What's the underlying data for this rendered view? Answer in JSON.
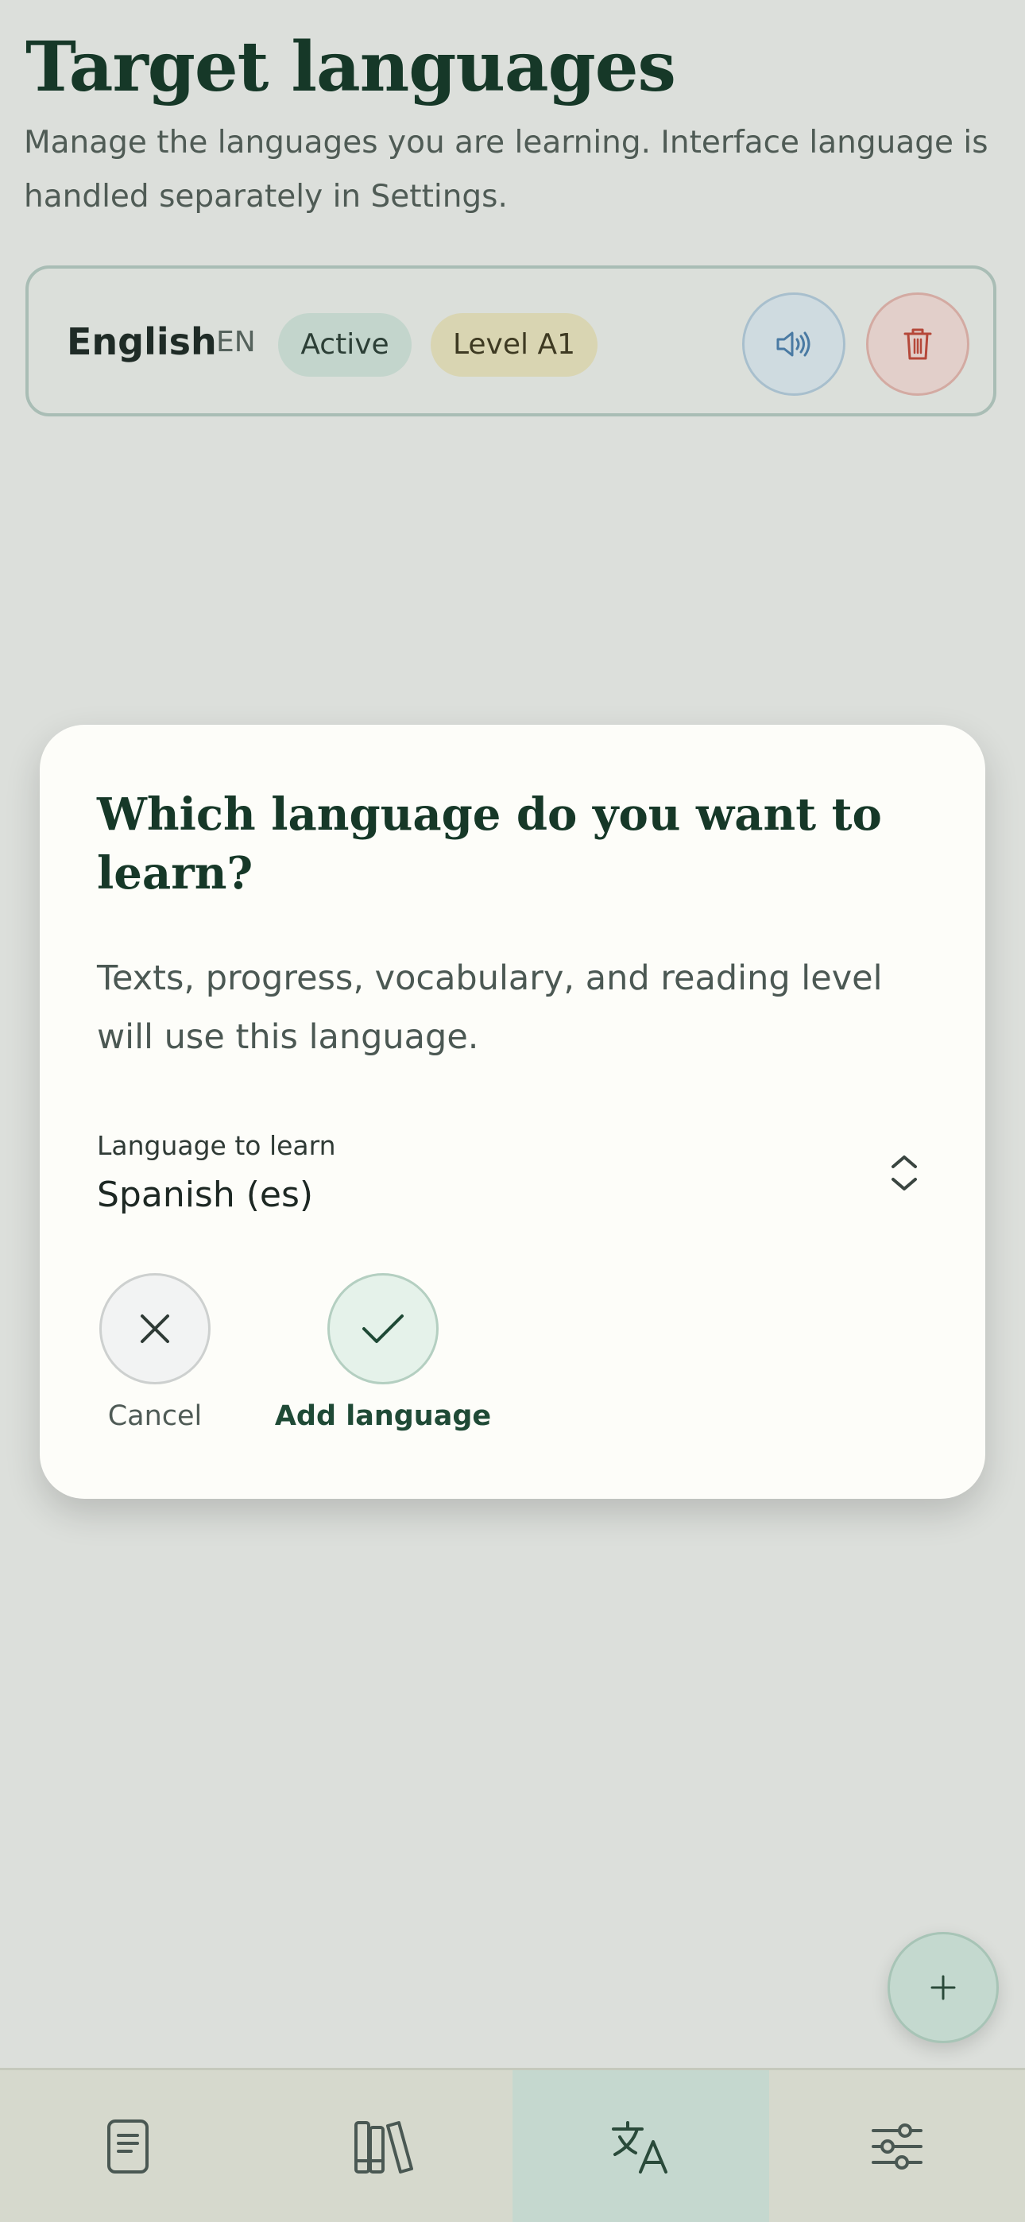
{
  "header": {
    "title": "Target languages",
    "subtitle": "Manage the languages you are learning. Interface language is handled separately in Settings."
  },
  "languages": [
    {
      "name": "English",
      "code": "EN",
      "status": "Active",
      "level": "Level A1",
      "actions": [
        "speaker-icon",
        "trash-icon"
      ]
    }
  ],
  "dialog": {
    "title": "Which language do you want to learn?",
    "description": "Texts, progress, vocabulary, and reading level will use this language.",
    "field_label": "Language to learn",
    "selected_value": "Spanish (es)",
    "cancel_label": "Cancel",
    "confirm_label": "Add language"
  },
  "fab": {
    "icon": "plus-icon"
  },
  "bottom_nav": [
    {
      "icon": "document-icon",
      "active": false
    },
    {
      "icon": "library-icon",
      "active": false
    },
    {
      "icon": "translate-icon",
      "active": true
    },
    {
      "icon": "sliders-icon",
      "active": false
    }
  ],
  "colors": {
    "accent": "#163828",
    "active_badge": "#c3d5cc",
    "level_badge": "#d9d5b2",
    "delete": "#b5483a",
    "speak": "#4a7aa3"
  }
}
